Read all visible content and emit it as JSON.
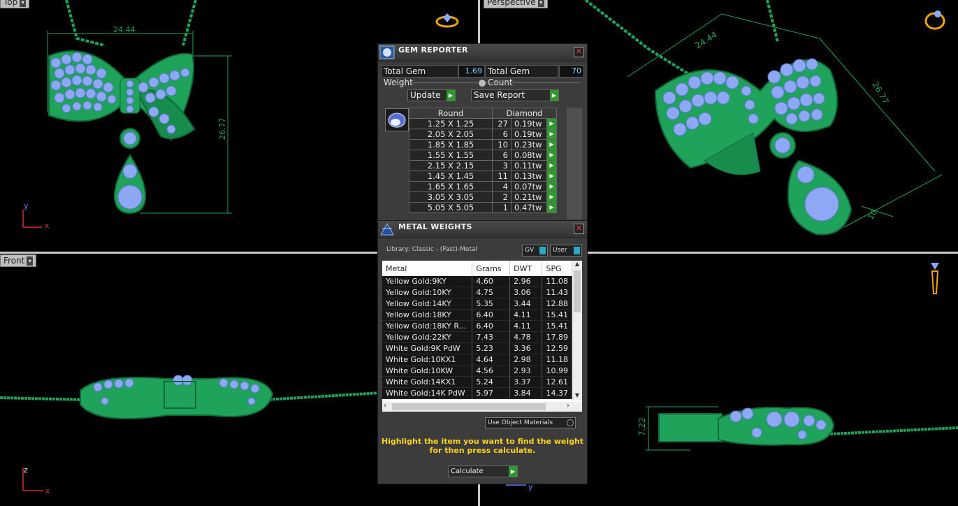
{
  "viewports": {
    "top": {
      "label": "Top",
      "dim_width": "24.44",
      "dim_height": "26.77",
      "axis_y": "y",
      "axis_x": "x"
    },
    "perspective": {
      "label": "Perspective",
      "dim_width": "24.44",
      "dim_height": "26.77",
      "dim_small": "10"
    },
    "front": {
      "label": "Front",
      "axis_z": "z",
      "axis_x": "x"
    },
    "right": {
      "dim_height": "7.22",
      "axis_y": "y"
    }
  },
  "gem_reporter": {
    "title": "GEM REPORTER",
    "total_weight_label": "Total Gem Weight",
    "total_weight_value": "1.69",
    "total_count_label": "Total Gem Count",
    "total_count_value": "70",
    "update_label": "Update",
    "save_report_label": "Save Report",
    "shape_header": "Round",
    "material_header": "Diamond",
    "rows": [
      {
        "size": "1.25 X 1.25",
        "count": "27",
        "weight": "0.19tw"
      },
      {
        "size": "2.05 X 2.05",
        "count": "6",
        "weight": "0.19tw"
      },
      {
        "size": "1.85 X 1.85",
        "count": "10",
        "weight": "0.23tw"
      },
      {
        "size": "1.55 X 1.55",
        "count": "6",
        "weight": "0.08tw"
      },
      {
        "size": "2.15 X 2.15",
        "count": "3",
        "weight": "0.11tw"
      },
      {
        "size": "1.45 X 1.45",
        "count": "11",
        "weight": "0.13tw"
      },
      {
        "size": "1.65 X 1.65",
        "count": "4",
        "weight": "0.07tw"
      },
      {
        "size": "3.05 X 3.05",
        "count": "2",
        "weight": "0.21tw"
      },
      {
        "size": "5.05 X 5.05",
        "count": "1",
        "weight": "0.47tw"
      }
    ]
  },
  "metal_weights": {
    "title": "METAL WEIGHTS",
    "library_label": "Library: Classic - (Fast)-Metal",
    "gv_label": "GV",
    "user_label": "User",
    "columns": [
      "Metal",
      "Grams",
      "DWT",
      "SPG"
    ],
    "rows": [
      [
        "Yellow Gold:9KY",
        "4.60",
        "2.96",
        "11.08"
      ],
      [
        "Yellow Gold:10KY",
        "4.75",
        "3.06",
        "11.43"
      ],
      [
        "Yellow Gold:14KY",
        "5.35",
        "3.44",
        "12.88"
      ],
      [
        "Yellow Gold:18KY",
        "6.40",
        "4.11",
        "15.41"
      ],
      [
        "Yellow Gold:18KY R...",
        "6.40",
        "4.11",
        "15.41"
      ],
      [
        "Yellow Gold:22KY",
        "7.43",
        "4.78",
        "17.89"
      ],
      [
        "White Gold:9K PdW",
        "5.23",
        "3.36",
        "12.59"
      ],
      [
        "White Gold:10KX1",
        "4.64",
        "2.98",
        "11.18"
      ],
      [
        "White Gold:10KW",
        "4.56",
        "2.93",
        "10.99"
      ],
      [
        "White Gold:14KX1",
        "5.24",
        "3.37",
        "12.61"
      ],
      [
        "White Gold:14K PdW",
        "5.97",
        "3.84",
        "14.37"
      ]
    ],
    "use_object_materials_label": "Use Object Materials",
    "hint_line1": "Highlight the item you want to find the weight",
    "hint_line2": "for then press calculate.",
    "calculate_label": "Calculate"
  },
  "colors": {
    "metal_green": "#1fa35a",
    "gem_blue": "#8fa8f5",
    "accent_yellow": "#ffd21a",
    "go_green": "#2e9a2e"
  }
}
